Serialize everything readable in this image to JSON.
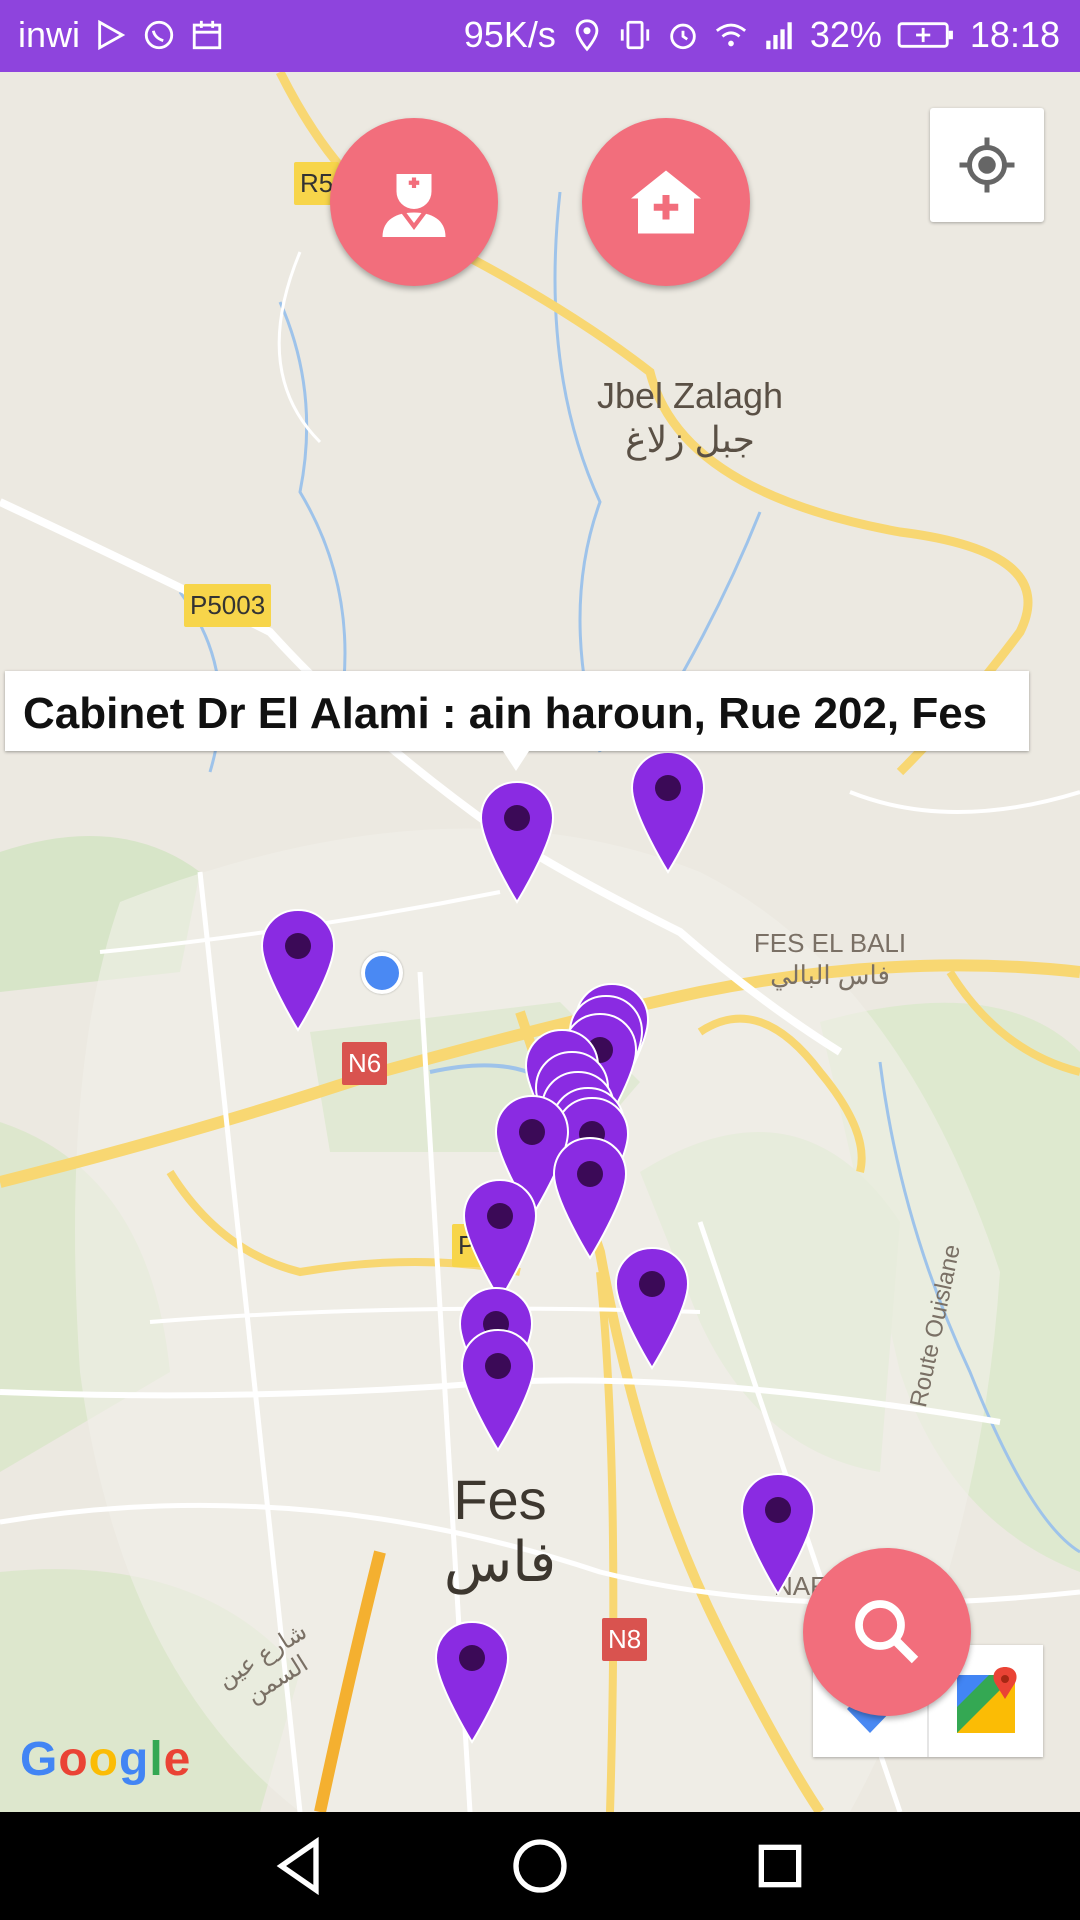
{
  "status_bar": {
    "carrier": "inwi",
    "net_speed": "95K/s",
    "battery": "32%",
    "time": "18:18"
  },
  "map": {
    "labels": {
      "jbel_zalagh": "Jbel Zalagh",
      "jbel_zalagh_ar": "جبل زلاغ",
      "fes_el_bali": "FES EL BALI",
      "fes_el_bali_ar": "فاس البالي",
      "fes": "Fes",
      "fes_ar": "فاس",
      "route_ouislane": "Route Ouislane",
      "street_ar": "شارع عين السمن",
      "nar": "NAF"
    },
    "road_tags": {
      "r5": "R5",
      "p5003": "P5003",
      "n6": "N6",
      "p": "P",
      "n8": "N8"
    },
    "google_logo": "Google"
  },
  "info_window": {
    "text": "Cabinet Dr El Alami : ain haroun, Rue 202, Fes"
  },
  "colors": {
    "status_bar": "#8e44dd",
    "marker": "#8a2be2",
    "fab": "#f26e7c"
  },
  "icons": {
    "doctor_fab": "doctor-icon",
    "hospital_fab": "hospital-icon",
    "search_fab": "search-icon",
    "locate": "my-location-icon",
    "maps": "google-maps-icon"
  }
}
